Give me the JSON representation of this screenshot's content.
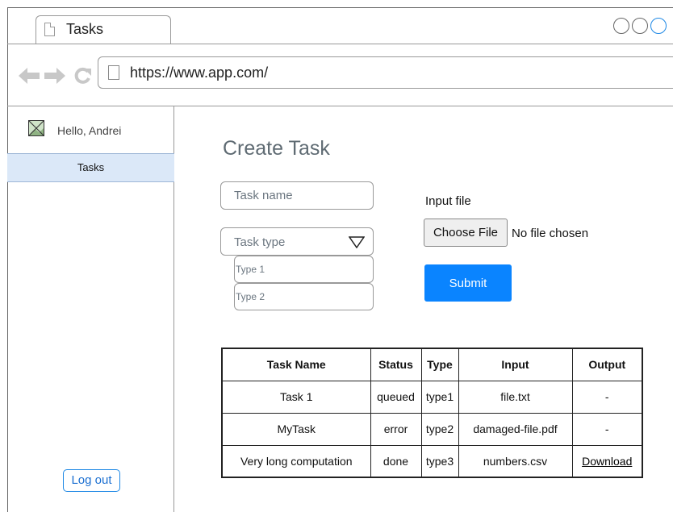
{
  "browser": {
    "tab_title": "Tasks",
    "url": "https://www.app.com/",
    "icons": [
      "back-arrow-icon",
      "forward-arrow-icon",
      "reload-icon",
      "page-icon"
    ]
  },
  "sidebar": {
    "greeting": "Hello, Andrei",
    "items": [
      {
        "label": "Tasks",
        "active": true
      }
    ],
    "logout_label": "Log out"
  },
  "main": {
    "title": "Create Task",
    "task_name_placeholder": "Task name",
    "task_type_placeholder": "Task type",
    "task_type_options": [
      "Type 1",
      "Type 2"
    ],
    "input_file_label": "Input file",
    "choose_file_label": "Choose File",
    "no_file_text": "No file chosen",
    "submit_label": "Submit"
  },
  "table": {
    "headers": [
      "Task Name",
      "Status",
      "Type",
      "Input",
      "Output"
    ],
    "rows": [
      [
        "Task 1",
        "queued",
        "type1",
        "file.txt",
        "-"
      ],
      [
        "MyTask",
        "error",
        "type2",
        "damaged-file.pdf",
        "-"
      ],
      [
        "Very long computation",
        "done",
        "type3",
        "numbers.csv",
        "Download"
      ]
    ]
  },
  "colors": {
    "accent": "#0a84ff",
    "active_nav_bg": "#dbe8f8",
    "title_text": "#5f6b73"
  }
}
